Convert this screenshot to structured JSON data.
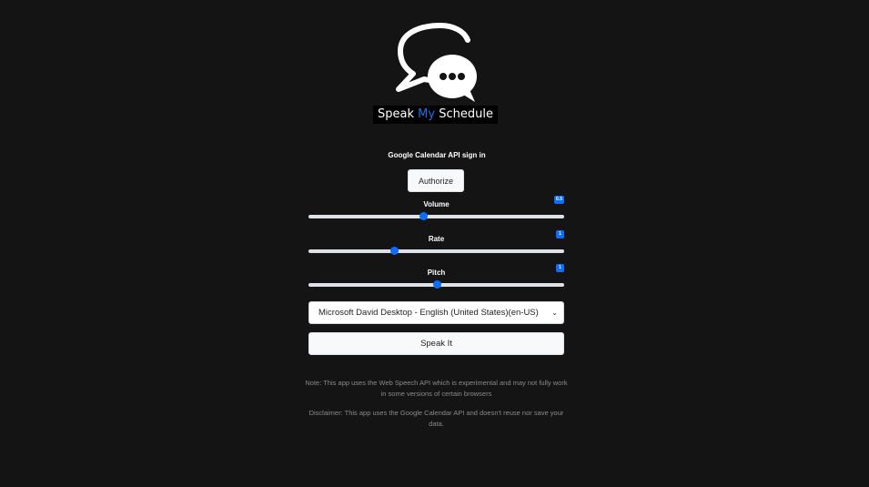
{
  "brand": {
    "part1": "Speak ",
    "part2": "My",
    "part3": " Schedule",
    "accent_color": "#1a73e8"
  },
  "auth": {
    "label": "Google Calendar API sign in",
    "button": "Authorize"
  },
  "sliders": {
    "volume": {
      "label": "Volume",
      "value": "0.5",
      "fraction": 0.45
    },
    "rate": {
      "label": "Rate",
      "value": "1",
      "fraction": 0.335
    },
    "pitch": {
      "label": "Pitch",
      "value": "1",
      "fraction": 0.5
    }
  },
  "voice": {
    "selected": "Microsoft David Desktop - English (United States)(en-US)"
  },
  "speak": {
    "button": "Speak It"
  },
  "notes": {
    "note": "Note: This app uses the Web Speech API which is experimental and may not fully work in some versions of certain browsers",
    "disclaimer": "Disclaimer: This app uses the Google Calendar API and doesn't reuse nor save your data."
  },
  "icons": {
    "logo": "chat-bubbles-icon",
    "select_arrow": "chevron-down-icon"
  }
}
